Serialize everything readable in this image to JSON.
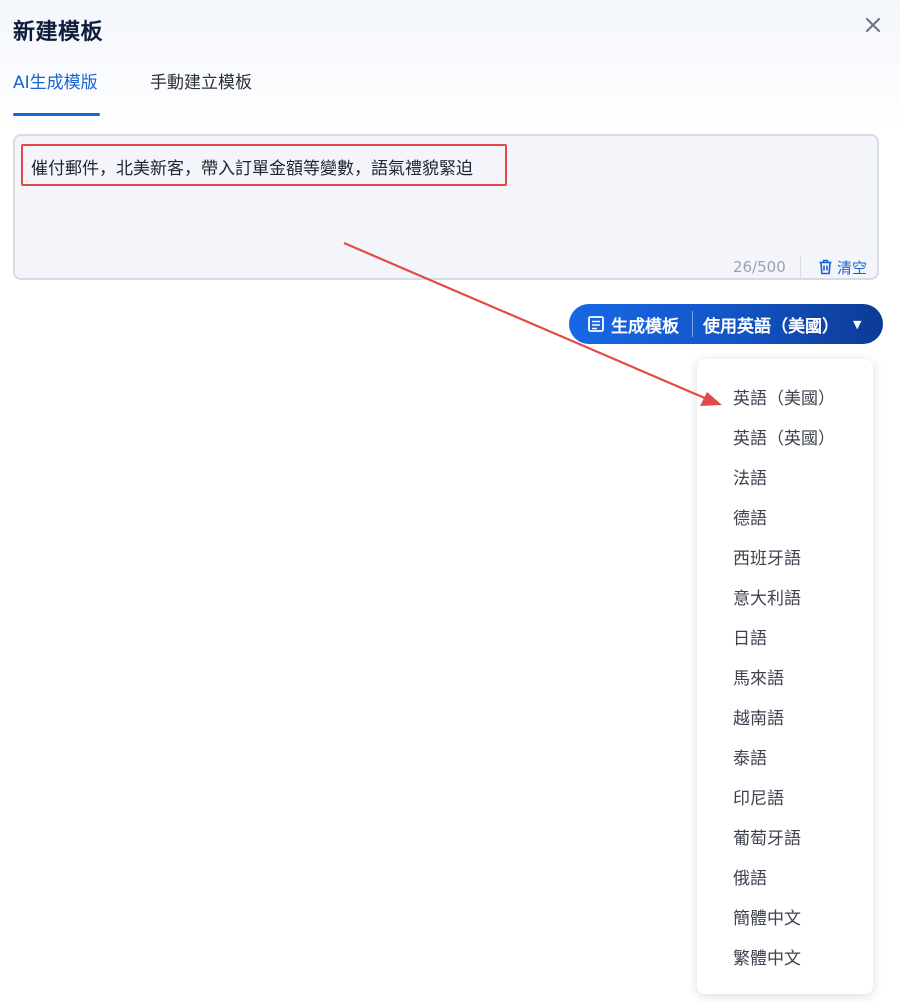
{
  "dialog": {
    "title": "新建模板",
    "close_icon": "close-icon"
  },
  "tabs": [
    {
      "label": "AI生成模版",
      "active": true
    },
    {
      "label": "手動建立模板",
      "active": false
    }
  ],
  "prompt": {
    "value": "催付郵件，北美新客，帶入訂單金額等變數，語氣禮貌緊迫",
    "counter": "26/500",
    "clear_label": "清空",
    "clear_icon": "trash-icon"
  },
  "actions": {
    "generate_label": "生成模板",
    "generate_icon": "document-icon",
    "language_label": "使用英語（美國）",
    "language_caret_icon": "caret-down-icon"
  },
  "language_options": [
    "英語（美國）",
    "英語（英國）",
    "法語",
    "德語",
    "西班牙語",
    "意大利語",
    "日語",
    "馬來語",
    "越南語",
    "泰語",
    "印尼語",
    "葡萄牙語",
    "俄語",
    "簡體中文",
    "繁體中文"
  ],
  "colors": {
    "accent": "#1a63d4",
    "highlight": "#e04b47",
    "arrow": "#e04b47"
  }
}
